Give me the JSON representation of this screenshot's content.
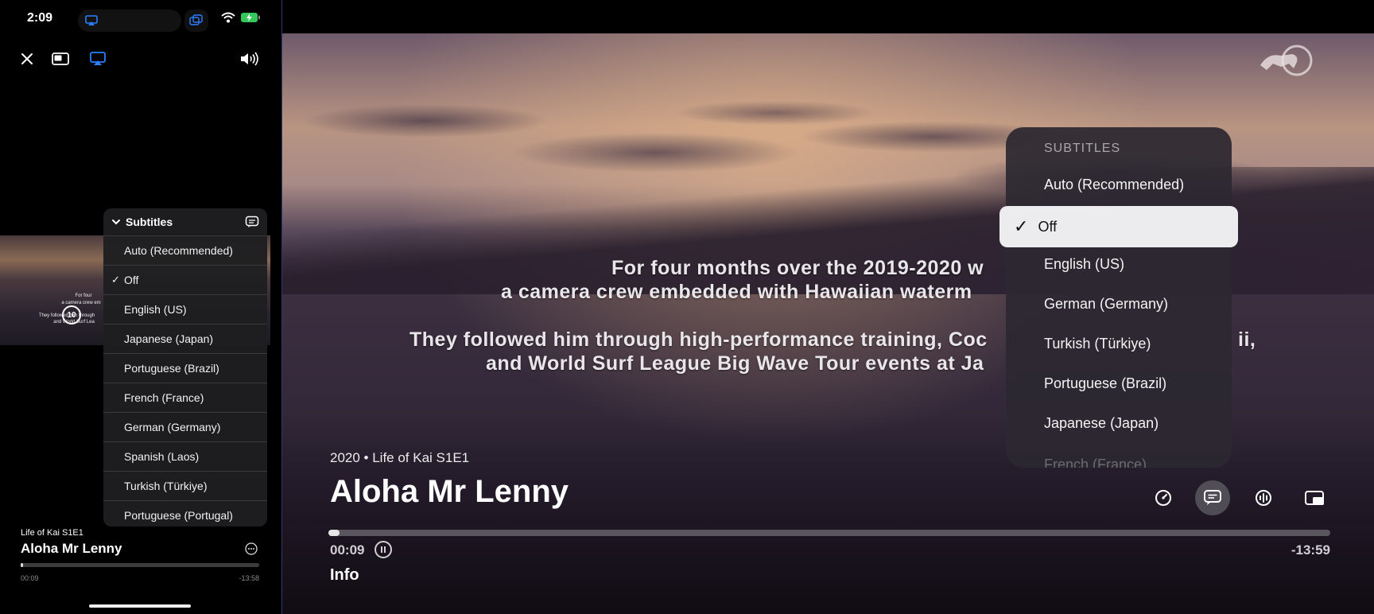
{
  "phone": {
    "status": {
      "time": "2:09"
    },
    "controls": {
      "close": "close-icon",
      "pip": "pip-icon",
      "airplay": "airplay-icon",
      "volume": "volume-icon"
    },
    "video_subtitles": {
      "line1": "For four",
      "line2": "a camera crew em",
      "line3": "They followed him through",
      "line4": "and World Surf Lea",
      "skip_label": "10"
    },
    "subtitles_menu": {
      "title": "Subtitles",
      "items": [
        {
          "label": "Auto (Recommended)",
          "checked": false
        },
        {
          "label": "Off",
          "checked": true
        },
        {
          "label": "English (US)",
          "checked": false
        },
        {
          "label": "Japanese (Japan)",
          "checked": false
        },
        {
          "label": "Portuguese (Brazil)",
          "checked": false
        },
        {
          "label": "French (France)",
          "checked": false
        },
        {
          "label": "German (Germany)",
          "checked": false
        },
        {
          "label": "Spanish (Laos)",
          "checked": false
        },
        {
          "label": "Turkish (Türkiye)",
          "checked": false
        },
        {
          "label": "Portuguese (Portugal)",
          "checked": false
        }
      ],
      "check_glyph": "✓"
    },
    "now_playing": {
      "series": "Life of Kai S1E1",
      "title": "Aloha Mr Lenny",
      "elapsed": "00:09",
      "remaining": "-13:58",
      "progress": 0.011
    }
  },
  "tv": {
    "subtitles": {
      "line1": "For four months over the 2019-2020 w",
      "line2": "a camera crew embedded with Hawaiian waterm",
      "line3": "They followed him through high-performance training, Coc",
      "line3_tail": "ii,",
      "line4": "and World Surf League Big Wave Tour events at Ja"
    },
    "meta": "2020 • Life of Kai S1E1",
    "title": "Aloha Mr Lenny",
    "elapsed": "00:09",
    "remaining": "-13:59",
    "progress": 0.011,
    "info_label": "Info",
    "controls": [
      "speed-icon",
      "subtitles-icon",
      "audio-icon",
      "pip-icon"
    ],
    "subtitles_menu": {
      "header": "SUBTITLES",
      "items": [
        {
          "label": "Auto (Recommended)",
          "checked": false
        },
        {
          "label": "Off",
          "checked": true
        },
        {
          "label": "English (US)",
          "checked": false
        },
        {
          "label": "German (Germany)",
          "checked": false
        },
        {
          "label": "Turkish (Türkiye)",
          "checked": false
        },
        {
          "label": "Portuguese (Brazil)",
          "checked": false
        },
        {
          "label": "Japanese (Japan)",
          "checked": false
        },
        {
          "label": "French (France)",
          "checked": false
        }
      ],
      "check_glyph": "✓"
    }
  },
  "colors": {
    "accent": "#2a7fff",
    "menu_bg": "#1e1e20",
    "selected_row": "#ecebed"
  }
}
